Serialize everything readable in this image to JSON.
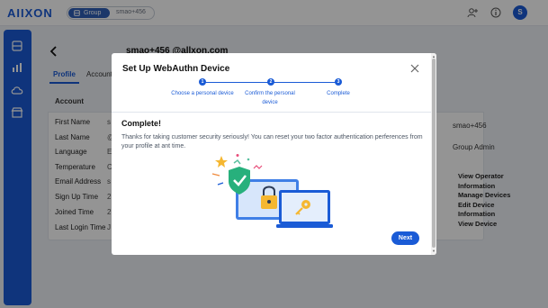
{
  "header": {
    "logo": "AIIXON",
    "switch_group_label": "Group",
    "switch_user_label": "smao+456",
    "avatar_initial": "S"
  },
  "profile": {
    "email": "smao+456 @allxon.com",
    "tabs": [
      "Profile",
      "Account"
    ],
    "section_title": "Account",
    "fields": [
      {
        "label": "First Name",
        "value": "s"
      },
      {
        "label": "Last Name",
        "value": "@"
      },
      {
        "label": "Language",
        "value": "E"
      },
      {
        "label": "Temperature",
        "value": "C"
      },
      {
        "label": "Email Address",
        "value": "s"
      },
      {
        "label": "Sign Up Time",
        "value": "2"
      },
      {
        "label": "Joined Time",
        "value": "2"
      },
      {
        "label": "Last Login Time",
        "value": "J"
      }
    ],
    "right_values": [
      "smao+456",
      "Group Admin"
    ],
    "permissions": [
      "View Operator",
      "Information",
      "Manage Devices",
      "Edit Device",
      "Information",
      "View Device"
    ]
  },
  "modal": {
    "title": "Set Up WebAuthn Device",
    "steps": [
      {
        "num": "1",
        "label": "Choose a personal device"
      },
      {
        "num": "2",
        "label": "Confirm the personal device"
      },
      {
        "num": "3",
        "label": "Complete"
      }
    ],
    "complete_title": "Complete!",
    "complete_text": "Thanks for taking customer security seriously! You can reset your two factor authentication perferences from your profile at ant time.",
    "next_label": "Next"
  },
  "colors": {
    "brand": "#1a5bd6",
    "overlay": "rgba(0,0,0,0.42)"
  }
}
